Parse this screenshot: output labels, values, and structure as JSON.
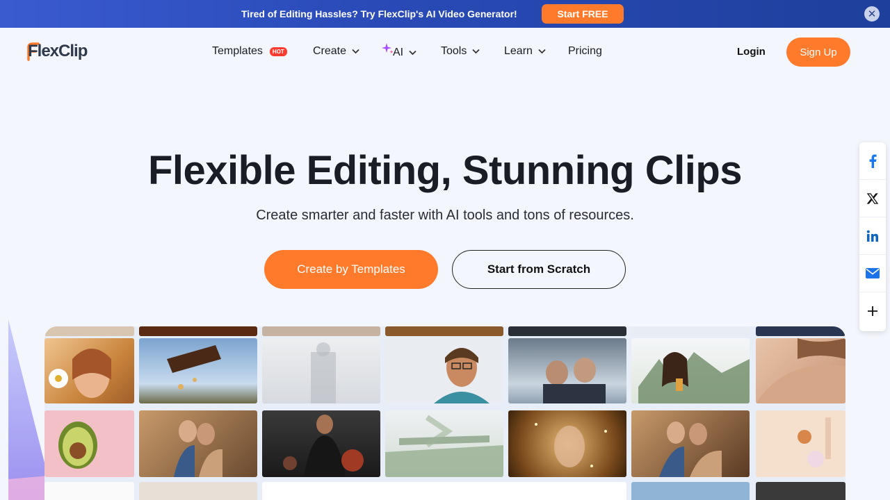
{
  "promo": {
    "text": "Tired of Editing Hassles? Try FlexClip's AI Video Generator!",
    "cta": "Start FREE",
    "close": "✕"
  },
  "nav": {
    "logo": "FlexClip",
    "items": [
      {
        "label": "Templates",
        "badge": "HOT"
      },
      {
        "label": "Create"
      },
      {
        "label": "AI"
      },
      {
        "label": "Tools"
      },
      {
        "label": "Learn"
      },
      {
        "label": "Pricing"
      }
    ],
    "login": "Login",
    "signup": "Sign Up"
  },
  "hero": {
    "title": "Flexible Editing, Stunning Clips",
    "subtitle": "Create smarter and faster with AI tools and tons of resources.",
    "primary_cta": "Create by Templates",
    "secondary_cta": "Start from Scratch"
  },
  "share": {
    "icons": [
      "facebook-icon",
      "x-icon",
      "linkedin-icon",
      "mail-icon",
      "plus-icon"
    ]
  },
  "colors": {
    "accent": "#ff7a2a",
    "banner": "#2a4bb8",
    "hot_badge": "#ff3b30"
  },
  "gallery": {
    "tiles": [
      "woman with flower",
      "beer toss",
      "faded figure",
      "smiling man with glasses",
      "couple in snow",
      "woman drinking",
      "woman shoulder",
      "avocado on pink",
      "couple dancing",
      "man lifting weights",
      "painted landscape",
      "golden sparkle face",
      "couple dancing",
      "skincare products"
    ]
  }
}
